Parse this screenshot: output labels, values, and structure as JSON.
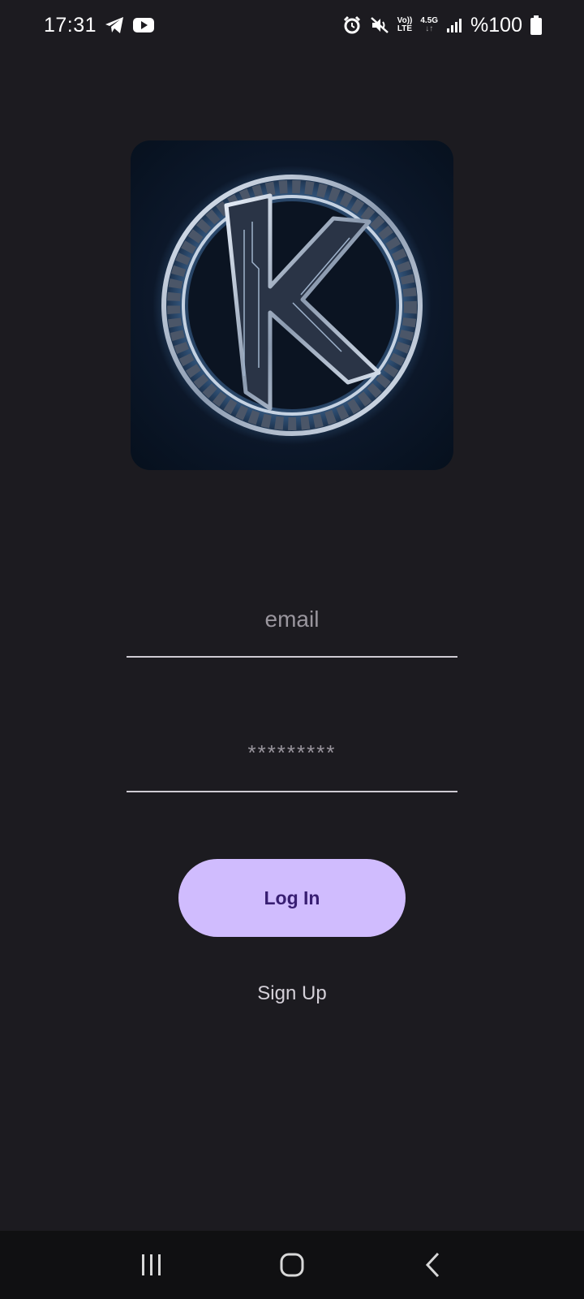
{
  "status_bar": {
    "time": "17:31",
    "left_icons": [
      "telegram-icon",
      "youtube-icon"
    ],
    "right_icons": [
      "alarm-icon",
      "mute-icon",
      "volte-icon",
      "network-4g-icon",
      "signal-icon",
      "battery-icon"
    ],
    "volte_label_top": "Vo))",
    "volte_label_bottom": "LTE",
    "network_label": "4.5G",
    "battery_text": "%100"
  },
  "logo": {
    "icon": "k-circuit-logo",
    "letter": "K"
  },
  "login_form": {
    "email_placeholder": "email",
    "email_value": "",
    "password_placeholder": "*********",
    "password_value": "",
    "login_label": "Log In",
    "signup_label": "Sign Up"
  },
  "nav_bar": {
    "icons": [
      "recent-apps-icon",
      "home-icon",
      "back-icon"
    ]
  },
  "colors": {
    "background": "#1c1b20",
    "primary_button": "#d0bcfe",
    "primary_button_text": "#381e72",
    "nav_background": "#101012"
  }
}
